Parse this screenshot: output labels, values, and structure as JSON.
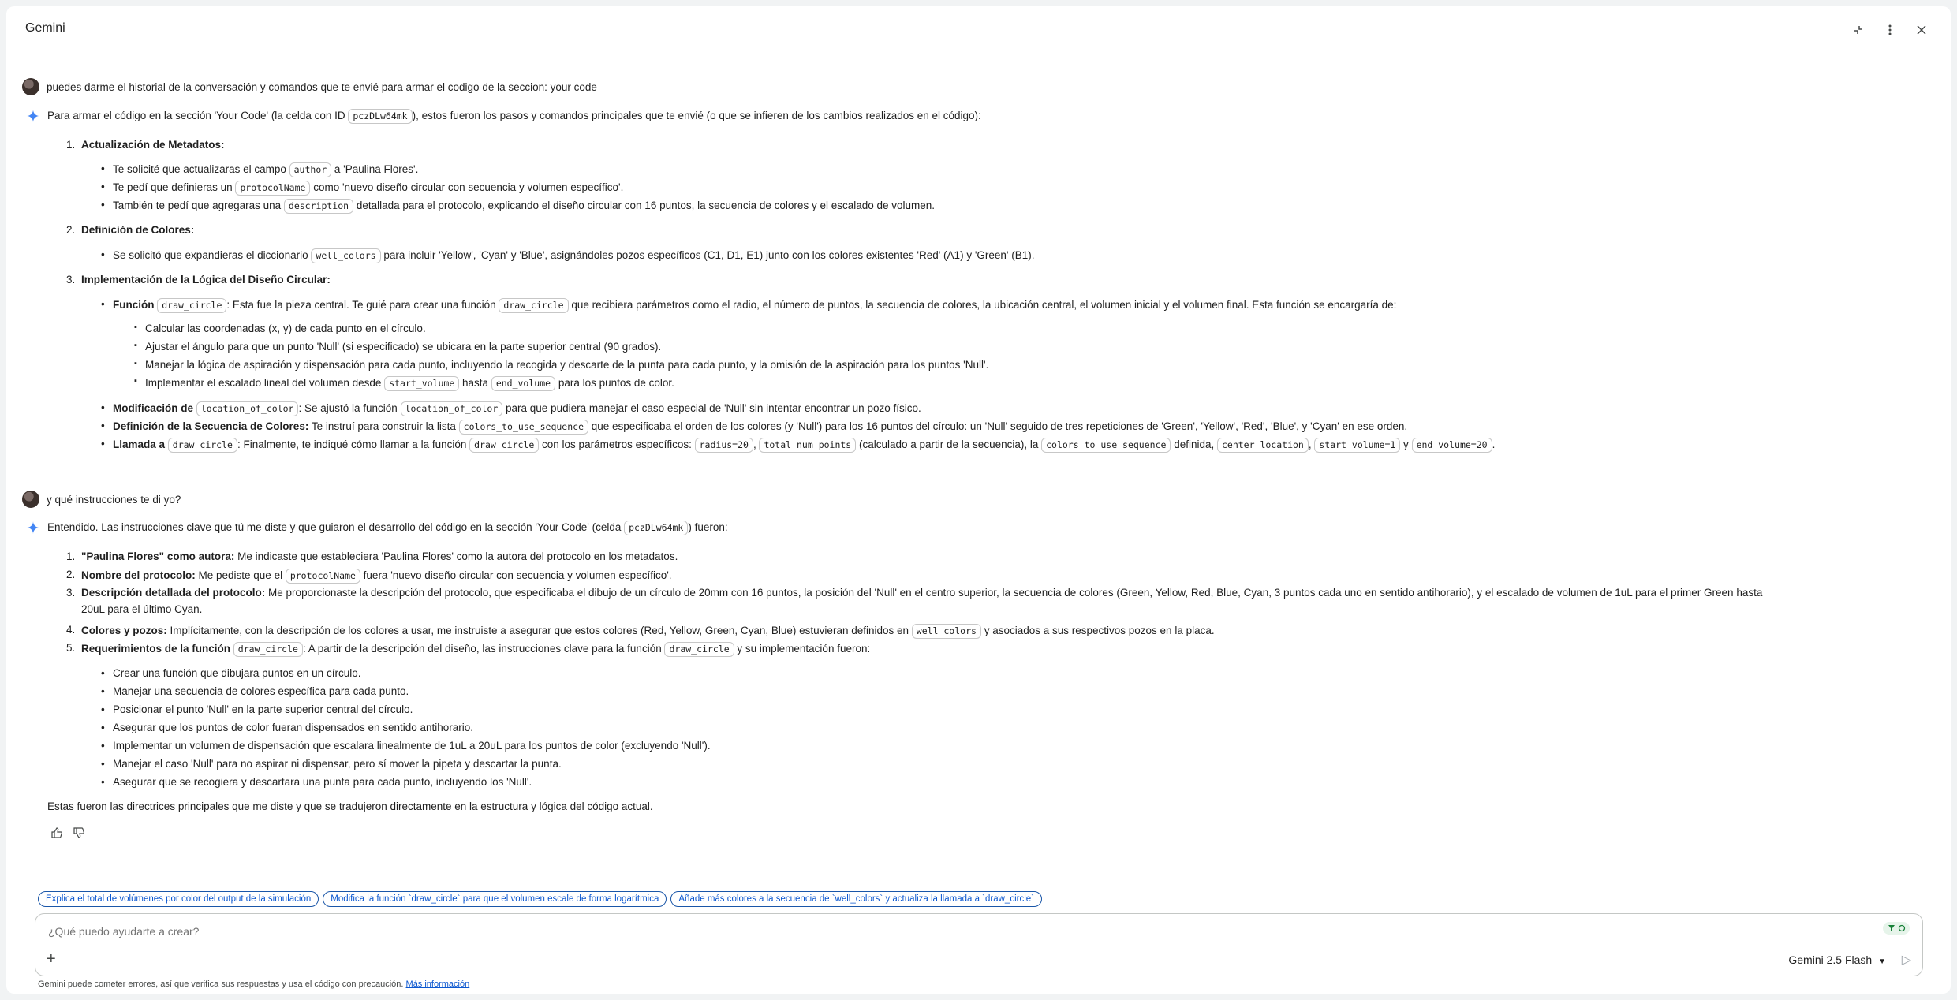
{
  "header": {
    "title": "Gemini",
    "icons": [
      "minimize-icon",
      "more-vert-icon",
      "close-icon"
    ]
  },
  "turn1": {
    "user": "puedes darme el historial de la conversación y comandos que te envié para armar el codigo de la seccion: your code",
    "intro_a": "Para armar el código en la sección 'Your Code' (la celda con ID ",
    "intro_code": "pczDLw64mk",
    "intro_b": "), estos fueron los pasos y comandos principales que te envié (o que se infieren de los cambios realizados en el código):",
    "s1": {
      "num": "1.",
      "title": "Actualización de Metadatos:",
      "b1_a": "Te solicité que actualizaras el campo ",
      "b1_code": "author",
      "b1_b": " a 'Paulina Flores'.",
      "b2_a": "Te pedí que definieras un ",
      "b2_code": "protocolName",
      "b2_b": " como 'nuevo diseño circular con secuencia y volumen específico'.",
      "b3_a": "También te pedí que agregaras una ",
      "b3_code": "description",
      "b3_b": " detallada para el protocolo, explicando el diseño circular con 16 puntos, la secuencia de colores y el escalado de volumen."
    },
    "s2": {
      "num": "2.",
      "title": "Definición de Colores:",
      "b1_a": "Se solicitó que expandieras el diccionario ",
      "b1_code": "well_colors",
      "b1_b": " para incluir 'Yellow', 'Cyan' y 'Blue', asignándoles pozos específicos (C1, D1, E1) junto con los colores existentes 'Red' (A1) y 'Green' (B1)."
    },
    "s3": {
      "num": "3.",
      "title": "Implementación de la Lógica del Diseño Circular:",
      "f_bold": "Función ",
      "f_code": "draw_circle",
      "f_a": ": Esta fue la pieza central. Te guié para crear una función ",
      "f_code2": "draw_circle",
      "f_b": " que recibiera parámetros como el radio, el número de puntos, la secuencia de colores, la ubicación central, el volumen inicial y el volumen final. Esta función se encargaría de:",
      "sub1": "Calcular las coordenadas (x, y) de cada punto en el círculo.",
      "sub2": "Ajustar el ángulo para que un punto 'Null' (si especificado) se ubicara en la parte superior central (90 grados).",
      "sub3": "Manejar la lógica de aspiración y dispensación para cada punto, incluyendo la recogida y descarte de la punta para cada punto, y la omisión de la aspiración para los puntos 'Null'.",
      "sub4_a": "Implementar el escalado lineal del volumen desde ",
      "sub4_code": "start_volume",
      "sub4_b": " hasta ",
      "sub4_code2": "end_volume",
      "sub4_c": " para los puntos de color.",
      "m_bold": "Modificación de ",
      "m_code": "location_of_color",
      "m_a": ": Se ajustó la función ",
      "m_code2": "location_of_color",
      "m_b": " para que pudiera manejar el caso especial de 'Null' sin intentar encontrar un pozo físico.",
      "d_bold": "Definición de la Secuencia de Colores:",
      "d_a": " Te instruí para construir la lista ",
      "d_code": "colors_to_use_sequence",
      "d_b": " que especificaba el orden de los colores (y 'Null') para los 16 puntos del círculo: un 'Null' seguido de tres repeticiones de 'Green', 'Yellow', 'Red', 'Blue', y 'Cyan' en ese orden.",
      "l_bold": "Llamada a ",
      "l_code": "draw_circle",
      "l_a": ": Finalmente, te indiqué cómo llamar a la función ",
      "l_code2": "draw_circle",
      "l_b": " con los parámetros específicos: ",
      "l_c1": "radius=20",
      "l_sep1": ", ",
      "l_c2": "total_num_points",
      "l_c": " (calculado a partir de la secuencia), la ",
      "l_c3": "colors_to_use_sequence",
      "l_d": " definida, ",
      "l_c4": "center_location",
      "l_sep2": ", ",
      "l_c5": "start_volume=1",
      "l_e": " y ",
      "l_c6": "end_volume=20",
      "l_f": "."
    }
  },
  "turn2": {
    "user": "y qué instrucciones te di yo?",
    "intro_a": "Entendido. Las instrucciones clave que tú me diste y que guiaron el desarrollo del código en la sección 'Your Code' (celda ",
    "intro_code": "pczDLw64mk",
    "intro_b": ") fueron:",
    "i1_bold": "\"Paulina Flores\" como autora:",
    "i1": " Me indicaste que estableciera 'Paulina Flores' como la autora del protocolo en los metadatos.",
    "i2_bold": "Nombre del protocolo:",
    "i2_a": " Me pediste que el ",
    "i2_code": "protocolName",
    "i2_b": " fuera 'nuevo diseño circular con secuencia y volumen específico'.",
    "i3_bold": "Descripción detallada del protocolo:",
    "i3": " Me proporcionaste la descripción del protocolo, que especificaba el dibujo de un círculo de 20mm con 16 puntos, la posición del 'Null' en el centro superior, la secuencia de colores (Green, Yellow, Red, Blue, Cyan, 3 puntos cada uno en sentido antihorario), y el escalado de volumen de 1uL para el primer Green hasta",
    "i3_cont": "20uL para el último Cyan.",
    "i4_bold": "Colores y pozos:",
    "i4_a": " Implícitamente, con la descripción de los colores a usar, me instruiste a asegurar que estos colores (Red, Yellow, Green, Cyan, Blue) estuvieran definidos en ",
    "i4_code": "well_colors",
    "i4_b": " y asociados a sus respectivos pozos en la placa.",
    "i5_bold": "Requerimientos de la función ",
    "i5_code": "draw_circle",
    "i5_a": ": A partir de la descripción del diseño, las instrucciones clave para la función ",
    "i5_code2": "draw_circle",
    "i5_b": " y su implementación fueron:",
    "r1": "Crear una función que dibujara puntos en un círculo.",
    "r2": "Manejar una secuencia de colores específica para cada punto.",
    "r3": "Posicionar el punto 'Null' en la parte superior central del círculo.",
    "r4": "Asegurar que los puntos de color fueran dispensados en sentido antihorario.",
    "r5": "Implementar un volumen de dispensación que escalara linealmente de 1uL a 20uL para los puntos de color (excluyendo 'Null').",
    "r6": "Manejar el caso 'Null' para no aspirar ni dispensar, pero sí mover la pipeta y descartar la punta.",
    "r7": "Asegurar que se recogiera y descartara una punta para cada punto, incluyendo los 'Null'.",
    "closing": "Estas fueron las directrices principales que me diste y que se tradujeron directamente en la estructura y lógica del código actual."
  },
  "suggestions": [
    "Explica el total de volúmenes por color del output de la simulación",
    "Modifica la función `draw_circle` para que el volumen escale de forma logarítmica",
    "Añade más colores a la secuencia de `well_colors` y actualiza la llamada a `draw_circle`"
  ],
  "composer": {
    "placeholder": "¿Qué puedo ayudarte a crear?",
    "model": "Gemini 2.5 Flash",
    "model_caret": "▼"
  },
  "disclaimer": {
    "text": "Gemini puede cometer errores, así que verifica sus respuestas y usa el código con precaución. ",
    "link": "Más información"
  }
}
